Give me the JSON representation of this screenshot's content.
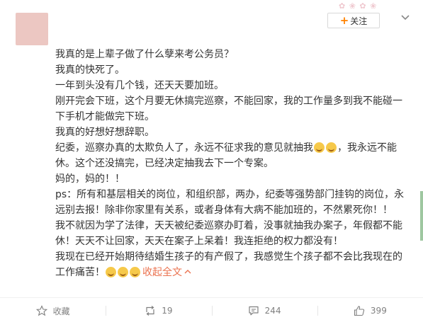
{
  "post": {
    "paragraphs": [
      [
        "我真的是上辈子做了什么孽来考公务员？"
      ],
      [
        "我真的快死了。"
      ],
      [
        "一年到头没有几个钱，还天天要加班。"
      ],
      [
        "刚开完会下班，这个月要无休搞完巡察，不能回家，我的工作量多到我不能碰一下手机才能做完下班。"
      ],
      [
        "我真的好想好想辞职。"
      ],
      [
        "纪委，巡察办真的太欺负人了，永远不征求我的意见就抽我",
        "[emoji]",
        "[emoji]",
        "，我永远不能休。这个还没搞完，已经决定抽我去下一个专案。"
      ],
      [
        "妈的，妈的！！"
      ],
      [
        "ps：所有和基层相关的岗位，和组织部，两办，纪委等强势部门挂钩的岗位，永远别去报！除非你家里有关系，或者身体有大病不能加班的，不然累死你！！"
      ],
      [
        "我不就因为学了法律，天天被纪委巡察办盯着，没事就抽我办案子，年假都不能休！天天不让回家，天天在案子上呆着！我连拒绝的权力都没有！"
      ],
      [
        "我现在已经开始期待结婚生孩子的有产假了，我感觉生个孩子都不会比我现在的工作痛苦！",
        "[emoji]",
        "[emoji]",
        "[emoji]"
      ]
    ],
    "collapse_label": "收起全文"
  },
  "header": {
    "follow_label": "关注"
  },
  "actions": {
    "favorite_label": "收藏",
    "repost_count": "19",
    "comment_count": "244",
    "like_count": "399"
  },
  "colors": {
    "accent": "#ff8200",
    "link": "#eb7350",
    "muted": "#808080"
  }
}
